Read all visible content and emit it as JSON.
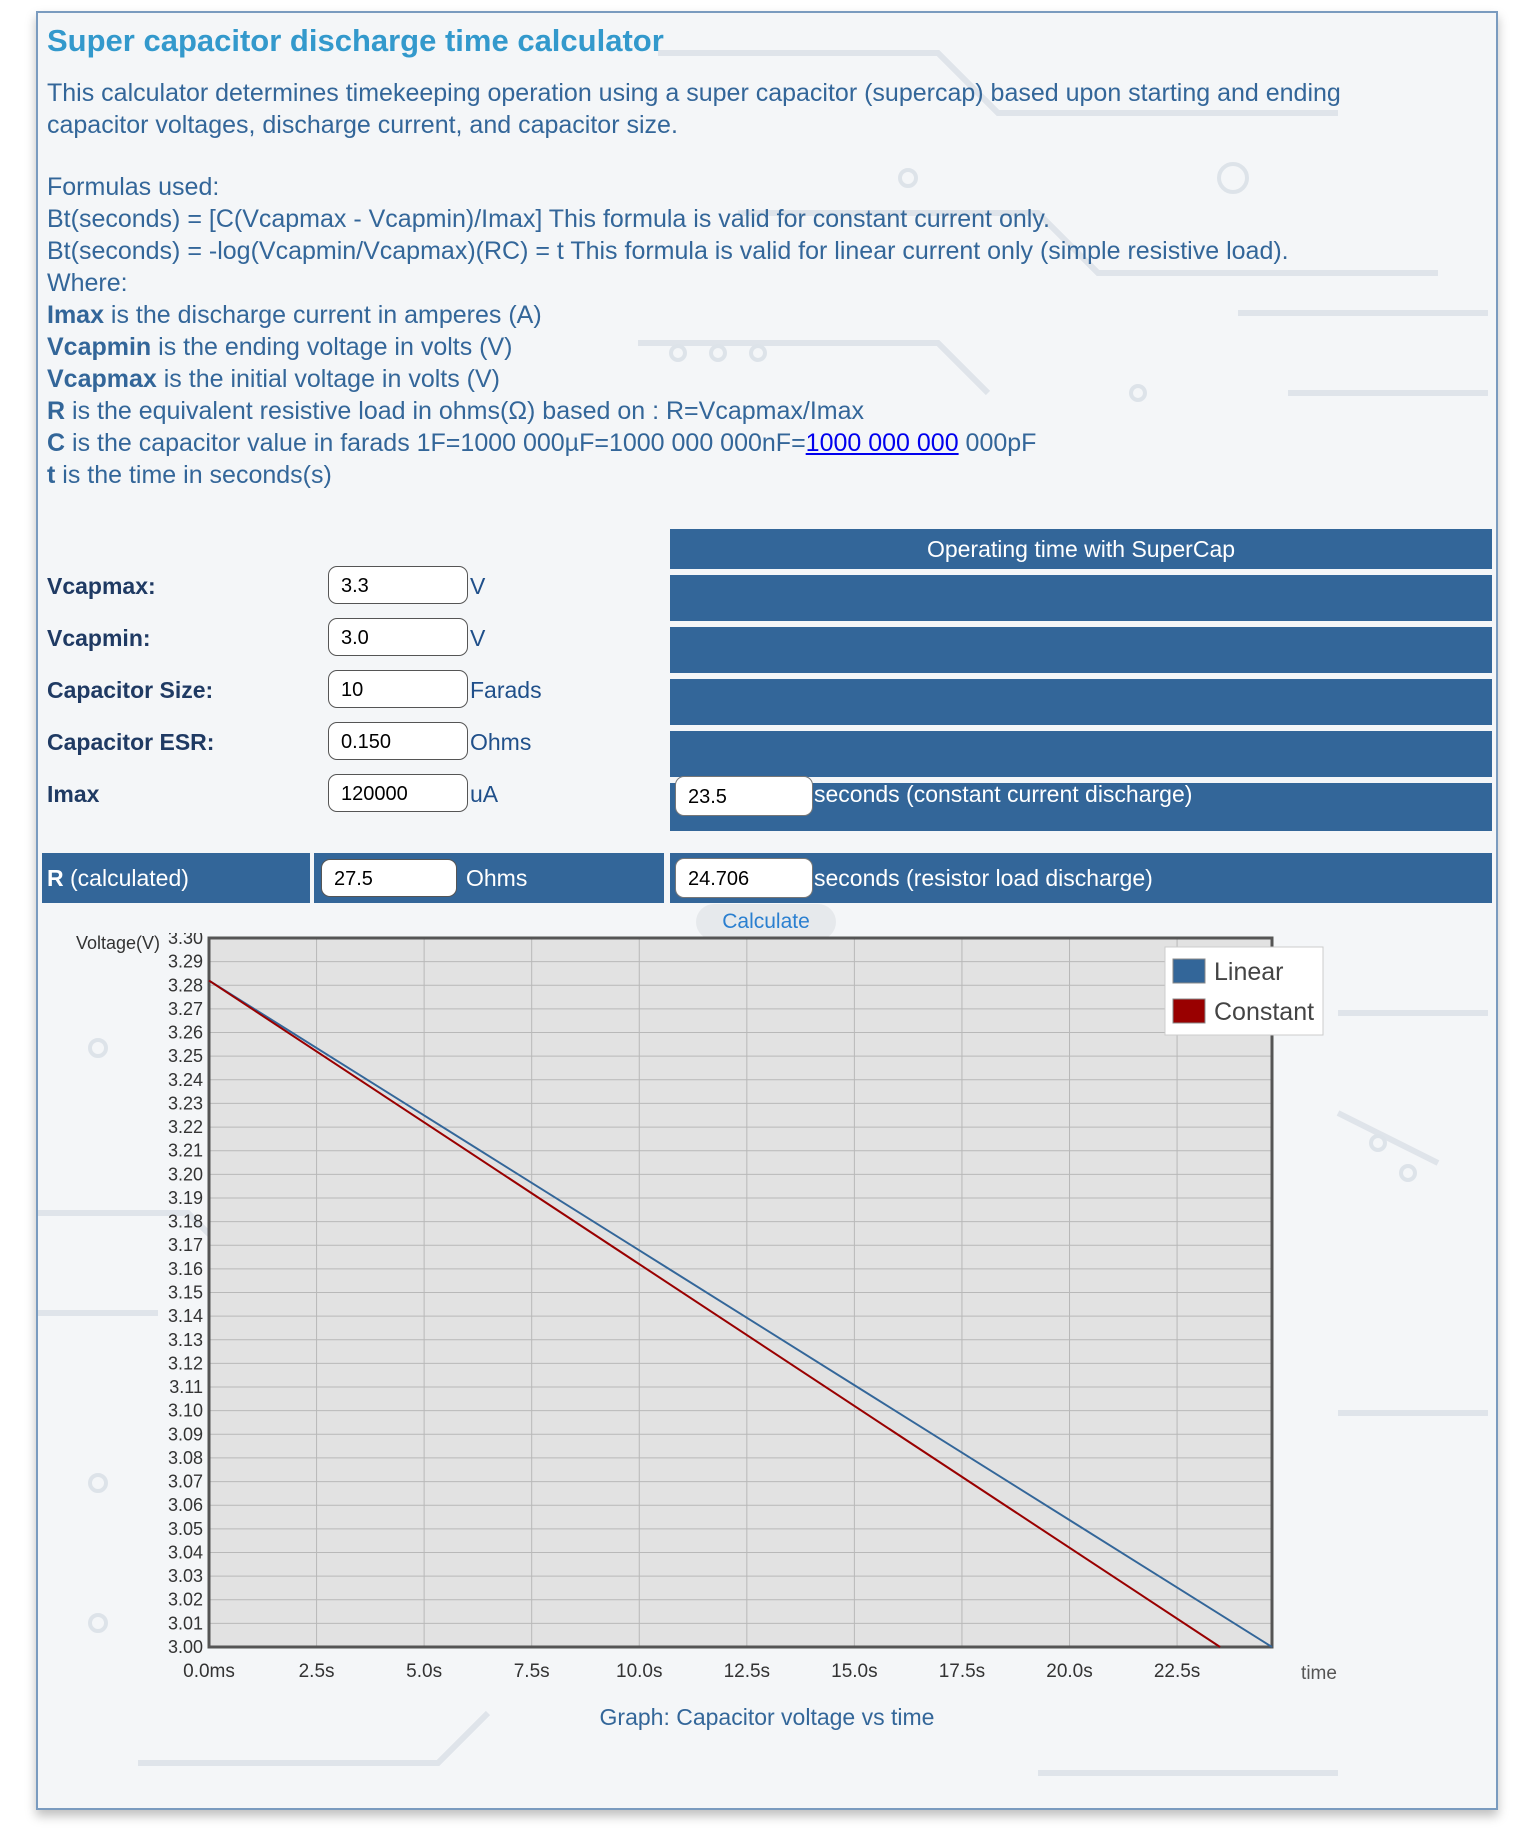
{
  "title": "Super capacitor discharge time calculator",
  "description": "This calculator determines timekeeping operation using a super capacitor (supercap) based upon starting and ending capacitor voltages, discharge current, and capacitor size.",
  "formulas": {
    "heading": "Formulas used:",
    "f1": "Bt(seconds) = [C(Vcapmax - Vcapmin)/Imax]  This formula is valid for constant current only.",
    "f2": "Bt(seconds) = -log(Vcapmin/Vcapmax)(RC) = t  This formula is valid for linear current only (simple resistive load).",
    "where": "Where:",
    "defs": [
      {
        "term": "Imax",
        "text": " is the discharge current in amperes (A)"
      },
      {
        "term": "Vcapmin",
        "text": " is the ending voltage in volts (V)"
      },
      {
        "term": "Vcapmax",
        "text": " is the initial voltage in volts (V)"
      },
      {
        "term": "R",
        "text": " is the equivalent resistive load in ohms(Ω) based on : R=Vcapmax/Imax"
      }
    ],
    "c_term": "C",
    "c_text": " is the capacitor value in farads 1F=1000 000µF=1000 000 000nF=",
    "c_link": "1000 000 000",
    "c_tail": " 000pF",
    "t_term": "t",
    "t_text": " is the time in seconds(s)"
  },
  "results_header": "Operating time with SuperCap",
  "fields": {
    "vcapmax": {
      "label": "Vcapmax:",
      "value": "3.3",
      "unit": "V"
    },
    "vcapmin": {
      "label": "Vcapmin:",
      "value": "3.0",
      "unit": "V"
    },
    "capsize": {
      "label": "Capacitor Size:",
      "value": "10",
      "unit": "Farads"
    },
    "esr": {
      "label": "Capacitor ESR:",
      "value": "0.150",
      "unit": "Ohms"
    },
    "imax": {
      "label": "Imax",
      "value": "120000",
      "unit": "uA"
    },
    "r": {
      "label_bold": "R",
      "label_rest": " (calculated)",
      "value": "27.5",
      "unit": "Ohms"
    }
  },
  "results": {
    "constant": {
      "value": "23.5",
      "label": "seconds (constant current discharge)"
    },
    "resistor": {
      "value": "24.706",
      "label": "seconds (resistor load discharge)"
    }
  },
  "calculate_label": "Calculate",
  "chart_data": {
    "type": "line",
    "ylabel": "Voltage(V)",
    "xlabel": "time",
    "caption": "Graph: Capacitor voltage vs time",
    "ylim": [
      3.0,
      3.3
    ],
    "xlim": [
      0,
      24.706
    ],
    "x_ticks": [
      "0.0ms",
      "2.5s",
      "5.0s",
      "7.5s",
      "10.0s",
      "12.5s",
      "15.0s",
      "17.5s",
      "20.0s",
      "22.5s"
    ],
    "y_ticks": [
      "3.30",
      "3.29",
      "3.28",
      "3.27",
      "3.26",
      "3.25",
      "3.24",
      "3.23",
      "3.22",
      "3.21",
      "3.20",
      "3.19",
      "3.18",
      "3.17",
      "3.16",
      "3.15",
      "3.14",
      "3.13",
      "3.12",
      "3.11",
      "3.10",
      "3.09",
      "3.08",
      "3.07",
      "3.06",
      "3.05",
      "3.04",
      "3.03",
      "3.02",
      "3.01",
      "3.00"
    ],
    "grid": true,
    "legend_position": "top-right",
    "series": [
      {
        "name": "Linear",
        "color": "#336699",
        "x": [
          0,
          24.706
        ],
        "y": [
          3.282,
          3.0
        ]
      },
      {
        "name": "Constant",
        "color": "#990000",
        "x": [
          0,
          23.5
        ],
        "y": [
          3.282,
          3.0
        ]
      }
    ]
  }
}
